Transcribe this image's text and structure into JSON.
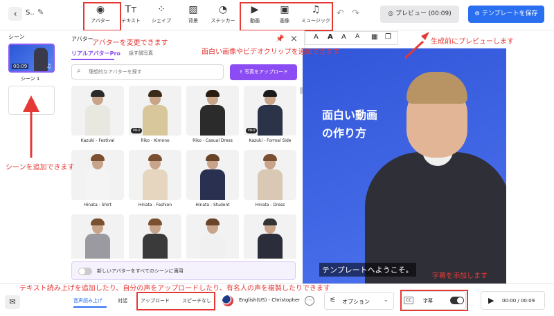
{
  "header": {
    "back_icon": "chevron-left-icon",
    "project_title": "S..",
    "tools": [
      {
        "label": "アバター",
        "icon": "◉"
      },
      {
        "label": "テキスト",
        "icon": "Tт"
      },
      {
        "label": "シェイプ",
        "icon": "⁘"
      },
      {
        "label": "背景",
        "icon": "▨"
      },
      {
        "label": "ステッカー",
        "icon": "◔"
      },
      {
        "label": "動画",
        "icon": "▶"
      },
      {
        "label": "画像",
        "icon": "▣"
      },
      {
        "label": "ミュージック",
        "icon": "♫"
      }
    ],
    "undo_icon": "↶",
    "redo_icon": "↷",
    "preview_label": "プレビュー (00:09)",
    "save_label": "テンプレートを保存"
  },
  "sidebar": {
    "label": "シーン",
    "scene_time": "00:09",
    "scene_name": "シーン 1",
    "add_icon": "+"
  },
  "avatar_panel": {
    "title": "アバター",
    "tab_real": "リアルアバターPro",
    "tab_talking": "話す顔写真",
    "search_placeholder": "理想的なアバターを探す",
    "upload_label": "写真をアップロード",
    "apply_all_label": "新しいアバターをすべてのシーンに適用",
    "avatars": [
      {
        "name": "Kazuki - Festival",
        "pro": false,
        "hair": "#2a2a2a",
        "outfit": "#e8e8e0"
      },
      {
        "name": "Riko - Kimono",
        "pro": true,
        "hair": "#3a2a1a",
        "outfit": "#d8c79a"
      },
      {
        "name": "Riko - Casual Dress",
        "pro": false,
        "hair": "#2a1a10",
        "outfit": "#2b2b2b"
      },
      {
        "name": "Kazuki - Formal Side",
        "pro": true,
        "hair": "#1a1a1a",
        "outfit": "#2a3348"
      },
      {
        "name": "Hinata - Shirt",
        "pro": false,
        "hair": "#7a5030",
        "outfit": "#f4f4f4"
      },
      {
        "name": "Hinata - Fashion",
        "pro": false,
        "hair": "#7a5030",
        "outfit": "#e6d6c0"
      },
      {
        "name": "Hinata - Student",
        "pro": false,
        "hair": "#6a4428",
        "outfit": "#2a3150"
      },
      {
        "name": "Hinata - Dress",
        "pro": false,
        "hair": "#7a5030",
        "outfit": "#d9c9b4"
      },
      {
        "name": "",
        "pro": false,
        "hair": "#7a5030",
        "outfit": "#9a9aa0"
      },
      {
        "name": "",
        "pro": false,
        "hair": "#7a5030",
        "outfit": "#3a3a3a"
      },
      {
        "name": "",
        "pro": false,
        "hair": "#6a4428",
        "outfit": "#f0f0f0"
      },
      {
        "name": "",
        "pro": false,
        "hair": "#333333",
        "outfit": "#2b2e3a"
      }
    ]
  },
  "text_toolbar": [
    "A",
    "A",
    "A",
    "A",
    "▦",
    "❐"
  ],
  "canvas": {
    "title": "面白い動画の作り方",
    "subtitle": "テンプレートへようこそ。"
  },
  "bottom": {
    "tabs": [
      "音声読み上げ",
      "対話",
      "アップロード",
      "スピーチなし"
    ],
    "voice_name": "English(US) - Christopher",
    "more_icon": "⋯",
    "options_label": "オプション",
    "cc_icon": "CC",
    "captions_label": "字幕",
    "time": "00:00 / 00:09"
  },
  "annotations": {
    "avatar": "アバターを変更できます",
    "media": "面白い画像やビデオクリップを追加できます",
    "preview": "生成前にプレビューします",
    "scene": "シーンを追加できます",
    "captions": "字幕を添加します",
    "voice": "テキスト読み上げを追加したり、自分の声をアップロードしたり、有名人の声を複製したりできます"
  },
  "colors": {
    "accent": "#2a6ff0",
    "purple": "#8c4cf4",
    "annotation": "#e53935"
  }
}
